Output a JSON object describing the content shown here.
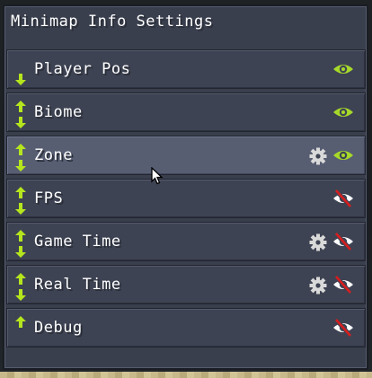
{
  "panel": {
    "title": "Minimap Info Settings"
  },
  "rows": [
    {
      "label": "Player Pos",
      "up": false,
      "down": true,
      "gear": false,
      "visible": true,
      "hover": false
    },
    {
      "label": "Biome",
      "up": true,
      "down": true,
      "gear": false,
      "visible": true,
      "hover": false
    },
    {
      "label": "Zone",
      "up": true,
      "down": true,
      "gear": true,
      "visible": true,
      "hover": true
    },
    {
      "label": "FPS",
      "up": true,
      "down": true,
      "gear": false,
      "visible": false,
      "hover": false
    },
    {
      "label": "Game Time",
      "up": true,
      "down": true,
      "gear": true,
      "visible": false,
      "hover": false
    },
    {
      "label": "Real Time",
      "up": true,
      "down": true,
      "gear": true,
      "visible": false,
      "hover": false
    },
    {
      "label": "Debug",
      "up": true,
      "down": false,
      "gear": false,
      "visible": false,
      "hover": false
    }
  ],
  "colors": {
    "arrow": "#b5e61d",
    "eye_on": "#a6d92a",
    "eye_off": "#ffffff",
    "slash": "#d61e1e",
    "gear": "#d9d9d9"
  },
  "icons": {
    "move_up": "arrow-up-icon",
    "move_down": "arrow-down-icon",
    "settings": "gear-icon",
    "visible": "eye-icon",
    "hidden": "eye-slash-icon",
    "pointer": "mouse-cursor-icon"
  }
}
